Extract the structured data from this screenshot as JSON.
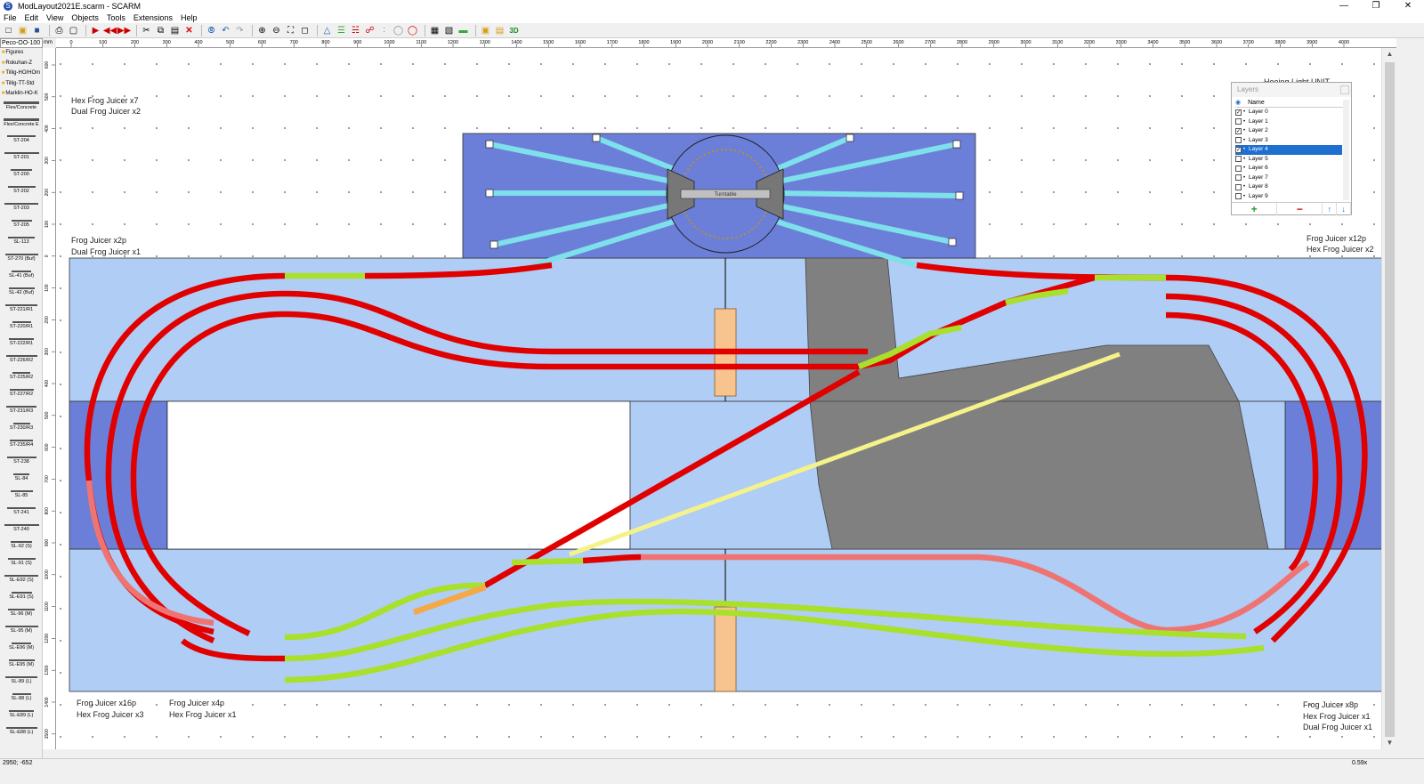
{
  "window": {
    "title": "ModLayout2021E.scarm - SCARM",
    "app_icon": "S",
    "controls": {
      "minimize": "—",
      "maximize": "❐",
      "close": "✕"
    }
  },
  "menu": [
    "File",
    "Edit",
    "View",
    "Objects",
    "Tools",
    "Extensions",
    "Help"
  ],
  "toolbar_icons": [
    "new-icon",
    "open-icon",
    "save-icon",
    "print-icon",
    "print-preview-icon",
    "arrow-right-icon",
    "rewind-icon",
    "forward-icon",
    "cut-icon",
    "copy-icon",
    "paste-icon",
    "delete-icon",
    "connect-icon",
    "undo-icon",
    "redo-icon",
    "zoom-in-icon",
    "zoom-out-icon",
    "zoom-fit-icon",
    "zoom-select-icon",
    "view-3d-icon",
    "layers-icon",
    "flex-track-icon",
    "turnout-icon",
    "track-tool-icon",
    "height-icon",
    "ruler-icon",
    "rolling-stock-icon",
    "train-icon",
    "track-color-icon",
    "plugin-icon",
    "box-icon",
    "3d-view-icon"
  ],
  "library": {
    "selected": "Peco-OO-100",
    "unit": "mm",
    "favorites": [
      "Figures",
      "Rokuhan-Z",
      "Tillig-HO/HOm",
      "Tillig-TT-Std",
      "Marklin-HO-K"
    ],
    "items": [
      "Flex/Concrete",
      "Flex/Concrete E",
      "ST-204",
      "ST-201",
      "ST-200",
      "ST-202",
      "ST-203",
      "ST-205",
      "SL-113",
      "ST-270 (Buf)",
      "SL-41 (Buf)",
      "SL-42 (Buf)",
      "ST-221/R1",
      "ST-220/R1",
      "ST-222/R1",
      "ST-226/R2",
      "ST-225/R2",
      "ST-227/R2",
      "ST-231/R3",
      "ST-230/R3",
      "ST-235/R4",
      "ST-238",
      "SL-84",
      "SL-85",
      "ST-241",
      "ST-240",
      "SL-92 (S)",
      "SL-91 (S)",
      "SL-E92 (S)",
      "SL-E91 (S)",
      "SL-96 (M)",
      "SL-95 (M)",
      "SL-E96 (M)",
      "SL-E95 (M)",
      "SL-89 (L)",
      "SL-88 (L)",
      "SL-E89 (L)",
      "SL-E88 (L)"
    ]
  },
  "ruler": {
    "h_ticks": [
      "0",
      "100",
      "200",
      "300",
      "400",
      "500",
      "600",
      "700",
      "800",
      "900",
      "1000",
      "1100",
      "1200",
      "1300",
      "1400",
      "1500",
      "1600",
      "1700",
      "1800",
      "1900",
      "2000",
      "2100",
      "2200",
      "2300",
      "2400",
      "2500",
      "2600",
      "2700",
      "2800",
      "2900",
      "3000",
      "3100",
      "3200",
      "3300",
      "3400",
      "3500",
      "3600",
      "3700",
      "3800",
      "3900",
      "4000"
    ],
    "v_ticks": [
      "600",
      "500",
      "400",
      "300",
      "200",
      "100",
      "0",
      "100",
      "200",
      "300",
      "400",
      "500",
      "600",
      "700",
      "800",
      "900",
      "1000",
      "1100",
      "1200",
      "1300",
      "1400",
      "1500",
      "1600"
    ]
  },
  "annotations": [
    {
      "id": "hex7",
      "text": "Hex Frog Juicer x7"
    },
    {
      "id": "dual2",
      "text": "Dual Frog Juicer x2"
    },
    {
      "id": "fj2p",
      "text": "Frog Juicer x2p"
    },
    {
      "id": "dual1a",
      "text": "Dual Frog Juicer x1"
    },
    {
      "id": "fj12p",
      "text": "Frog Juicer x12p"
    },
    {
      "id": "hex2",
      "text": "Hex Frog Juicer x2"
    },
    {
      "id": "fj16p",
      "text": "Frog Juicer x16p"
    },
    {
      "id": "hex3",
      "text": "Hex Frog Juicer x3"
    },
    {
      "id": "fj4p",
      "text": "Frog Juicer x4p"
    },
    {
      "id": "hex1a",
      "text": "Hex Frog Juicer x1"
    },
    {
      "id": "fj8p",
      "text": "Frog Juicer x8p"
    },
    {
      "id": "hex1b",
      "text": "Hex Frog Juicer x1"
    },
    {
      "id": "dual1b",
      "text": "Dual Frog Juicer x1"
    },
    {
      "id": "hoeing",
      "text": "Hoeing Light UNIT"
    }
  ],
  "turntable_label": "Turntable",
  "layers_panel": {
    "title": "Layers",
    "column": "Name",
    "rows": [
      {
        "name": "Layer 0",
        "checked": true,
        "selected": false
      },
      {
        "name": "Layer 1",
        "checked": false,
        "selected": false
      },
      {
        "name": "Layer 2",
        "checked": true,
        "selected": false
      },
      {
        "name": "Layer 3",
        "checked": false,
        "selected": false
      },
      {
        "name": "Layer 4",
        "checked": true,
        "selected": true
      },
      {
        "name": "Layer 5",
        "checked": false,
        "selected": false
      },
      {
        "name": "Layer 6",
        "checked": false,
        "selected": false
      },
      {
        "name": "Layer 7",
        "checked": false,
        "selected": false
      },
      {
        "name": "Layer 8",
        "checked": false,
        "selected": false
      },
      {
        "name": "Layer 9",
        "checked": false,
        "selected": false
      }
    ],
    "add": "+",
    "remove": "−",
    "up": "↑",
    "down": "↓"
  },
  "status": {
    "coords": "2950; -652",
    "zoom": "0.59x"
  },
  "colors": {
    "baseboard": "#b0cdf5",
    "baseboard_dark": "#6c7fd8",
    "track_red": "#e00000",
    "track_pink": "#ee7474",
    "track_green": "#a8e02c",
    "track_cyan": "#7ee0ea",
    "track_yellow": "#f6f28a",
    "track_orange": "#f5a846",
    "gray_area": "#808080",
    "bridge": "#f7c48f"
  }
}
